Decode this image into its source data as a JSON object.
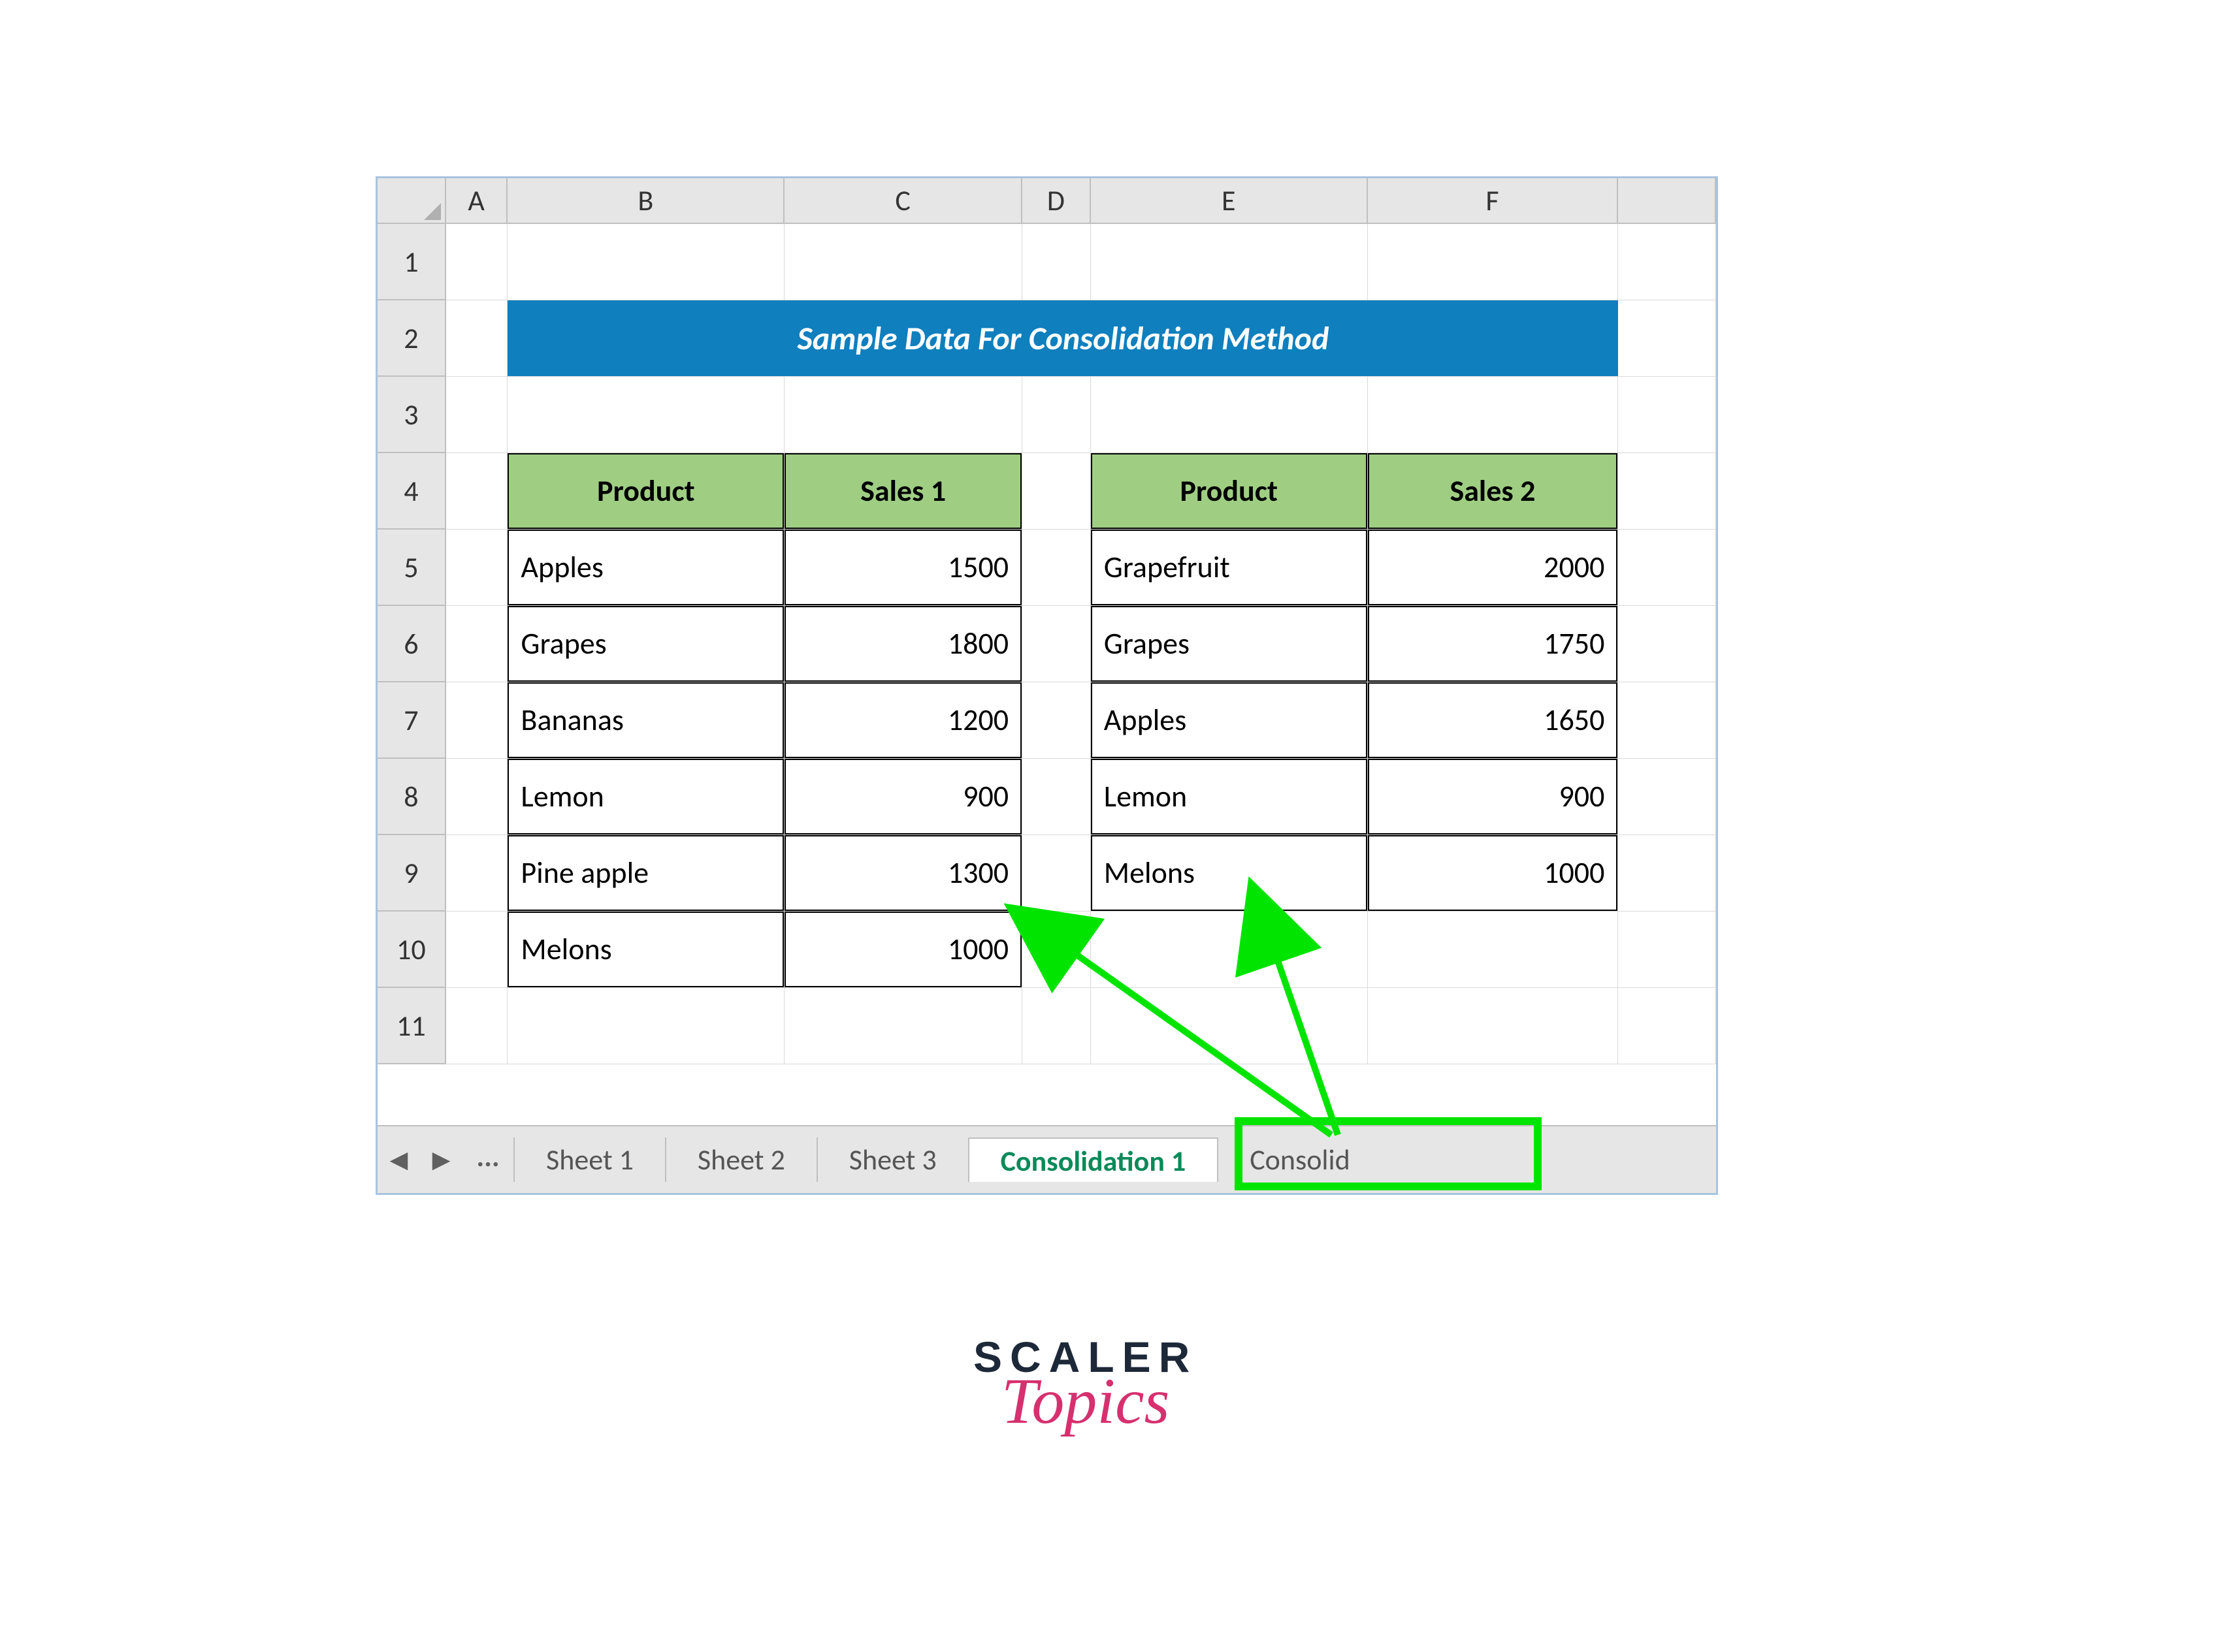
{
  "columns": [
    "A",
    "B",
    "C",
    "D",
    "E",
    "F"
  ],
  "rows": [
    "1",
    "2",
    "3",
    "4",
    "5",
    "6",
    "7",
    "8",
    "9",
    "10",
    "11"
  ],
  "banner": "Sample Data For Consolidation Method",
  "table1": {
    "headers": [
      "Product",
      "Sales 1"
    ],
    "rows": [
      {
        "product": "Apples",
        "value": "1500"
      },
      {
        "product": "Grapes",
        "value": "1800"
      },
      {
        "product": "Bananas",
        "value": "1200"
      },
      {
        "product": "Lemon",
        "value": "900"
      },
      {
        "product": "Pine apple",
        "value": "1300"
      },
      {
        "product": "Melons",
        "value": "1000"
      }
    ]
  },
  "table2": {
    "headers": [
      "Product",
      "Sales 2"
    ],
    "rows": [
      {
        "product": "Grapefruit",
        "value": "2000"
      },
      {
        "product": "Grapes",
        "value": "1750"
      },
      {
        "product": "Apples",
        "value": "1650"
      },
      {
        "product": "Lemon",
        "value": "900"
      },
      {
        "product": "Melons",
        "value": "1000"
      }
    ]
  },
  "tabs": {
    "ellipsis": "...",
    "items": [
      "Sheet 1",
      "Sheet 2",
      "Sheet 3",
      "Consolidation 1",
      "Consolid"
    ],
    "active_index": 3
  },
  "logo": {
    "line1": "SCALER",
    "line2": "Topics"
  }
}
